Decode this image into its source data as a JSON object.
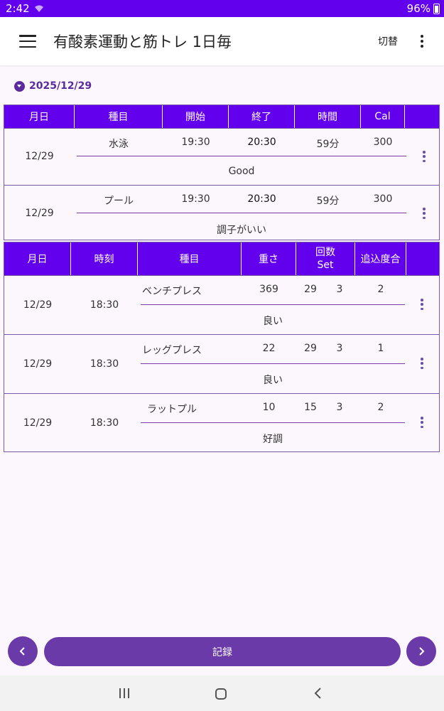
{
  "status": {
    "time": "2:42",
    "battery": "96%"
  },
  "app_bar": {
    "title": "有酸素運動と筋トレ 1日毎",
    "switch_label": "切替"
  },
  "date_selector": {
    "date": "2025/12/29"
  },
  "cardio": {
    "headers": [
      "月日",
      "種目",
      "開始",
      "終了",
      "時間",
      "Cal"
    ],
    "rows": [
      {
        "date": "12/29",
        "activity": "水泳",
        "start": "19:30",
        "end": "20:30",
        "duration": "59分",
        "cal": "300",
        "memo": "Good"
      },
      {
        "date": "12/29",
        "activity": "プール",
        "start": "19:30",
        "end": "20:30",
        "duration": "59分",
        "cal": "300",
        "memo": "調子がいい"
      }
    ]
  },
  "strength": {
    "headers": {
      "date": "月日",
      "time": "時刻",
      "exercise": "種目",
      "weight": "重さ",
      "reps_line1": "回数",
      "reps_line2": "Set",
      "extra": "追込度合"
    },
    "rows": [
      {
        "date": "12/29",
        "time": "18:30",
        "exercise": "ベンチプレス",
        "weight": "369",
        "reps": "29",
        "sets": "3",
        "extra": "2",
        "memo": "良い"
      },
      {
        "date": "12/29",
        "time": "18:30",
        "exercise": "レッグプレス",
        "weight": "22",
        "reps": "29",
        "sets": "3",
        "extra": "1",
        "memo": "良い"
      },
      {
        "date": "12/29",
        "time": "18:30",
        "exercise": "ラットプル",
        "weight": "10",
        "reps": "15",
        "sets": "3",
        "extra": "2",
        "memo": "好調"
      }
    ]
  },
  "bottom": {
    "record_label": "記録"
  },
  "icons": {
    "menu": "hamburger-icon",
    "more": "more-vert-icon",
    "prev": "chevron-left-icon",
    "next": "chevron-right-icon"
  },
  "colors": {
    "primary": "#6200ee",
    "accent": "#6a3aa8",
    "background": "#fcf6fd"
  }
}
